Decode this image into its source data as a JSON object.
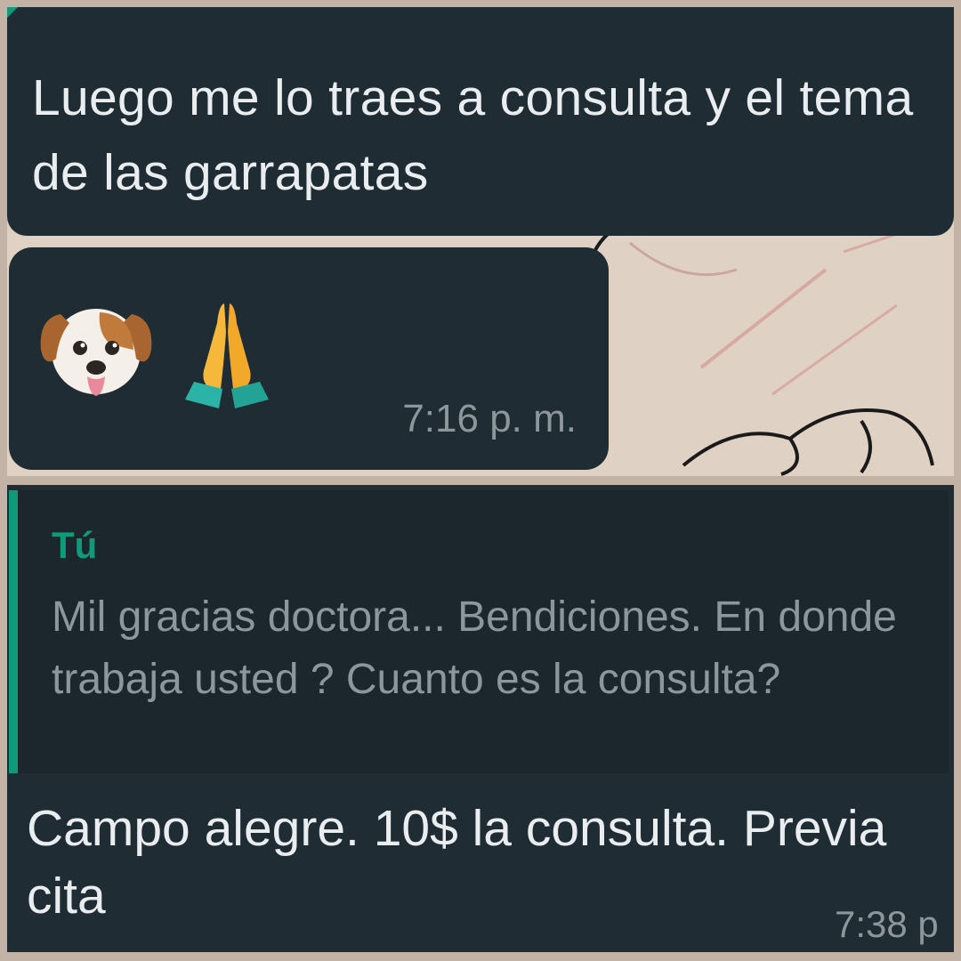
{
  "messages": [
    {
      "text": "Luego me lo traes a consulta y el tema de las garrapatas"
    },
    {
      "emojis": [
        "dog-face-icon",
        "folded-hands-icon"
      ],
      "time": "7:16 p. m."
    }
  ],
  "reply": {
    "quoted_author": "Tú",
    "quoted_text": "Mil gracias doctora... Bendiciones. En donde trabaja usted ? Cuanto es la consulta?",
    "text": "Campo alegre. 10$ la consulta. Previa cita",
    "time": "7:38 p"
  },
  "colors": {
    "bubble_bg": "#1f2c33",
    "accent_green": "#0f9b7a",
    "text_primary": "#e9edef",
    "text_secondary": "#8b969d",
    "collage_border": "#c3b3a7",
    "wallpaper": "#dfd0c4"
  }
}
